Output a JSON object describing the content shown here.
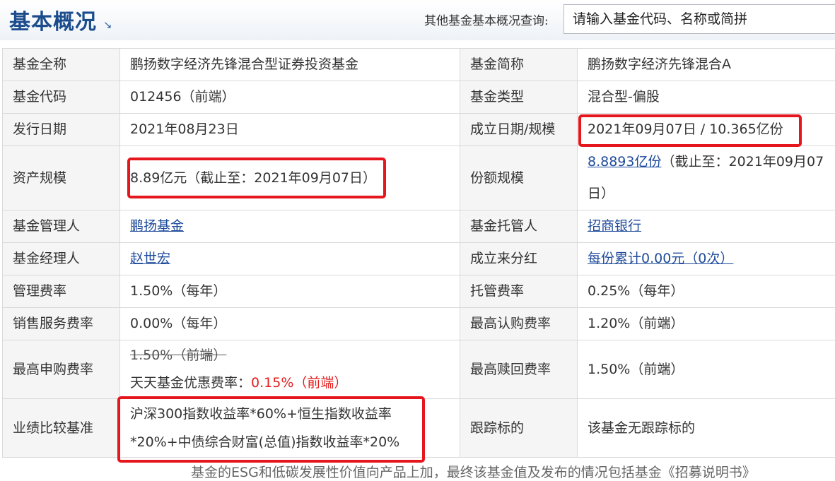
{
  "header": {
    "title": "基本概况",
    "arrow": "↘",
    "search_label": "其他基金基本概况查询:",
    "search_placeholder": "请输入基金代码、名称或简拼"
  },
  "rows": {
    "full_name": {
      "label": "基金全称",
      "value": "鹏扬数字经济先锋混合型证券投资基金"
    },
    "short_name": {
      "label": "基金简称",
      "value": "鹏扬数字经济先锋混合A"
    },
    "code": {
      "label": "基金代码",
      "value": "012456（前端）"
    },
    "type": {
      "label": "基金类型",
      "value": "混合型-偏股"
    },
    "issue_date": {
      "label": "发行日期",
      "value": "2021年08月23日"
    },
    "establish": {
      "label": "成立日期/规模",
      "value": "2021年09月07日 / 10.365亿份"
    },
    "assets": {
      "label": "资产规模",
      "value": "8.89亿元（截止至：2021年09月07日）"
    },
    "shares": {
      "label": "份额规模",
      "link": "8.8893亿份",
      "suffix": "（截止至：2021年09月07日）"
    },
    "manager_co": {
      "label": "基金管理人",
      "link": "鹏扬基金"
    },
    "custodian": {
      "label": "基金托管人",
      "link": "招商银行"
    },
    "manager": {
      "label": "基金经理人",
      "link": "赵世宏"
    },
    "dividend": {
      "label": "成立来分红",
      "link": "每份累计0.00元（0次）"
    },
    "mgmt_fee": {
      "label": "管理费率",
      "value": "1.50%（每年）"
    },
    "custody_fee": {
      "label": "托管费率",
      "value": "0.25%（每年）"
    },
    "sales_fee": {
      "label": "销售服务费率",
      "value": "0.00%（每年）"
    },
    "max_sub_fee": {
      "label": "最高认购费率",
      "value": "1.20%（前端）"
    },
    "max_purchase_fee": {
      "label": "最高申购费率",
      "original": "1.50%（前端）",
      "discount_label": "天天基金优惠费率：",
      "discount_value": "0.15%（前端）"
    },
    "max_redeem_fee": {
      "label": "最高赎回费率",
      "value": "1.50%（前端）"
    },
    "benchmark": {
      "label": "业绩比较基准",
      "line1": "沪深300指数收益率*60%+恒生指数收益率",
      "line2": "*20%+中债综合财富(总值)指数收益率*20%"
    },
    "tracking": {
      "label": "跟踪标的",
      "value": "该基金无跟踪标的"
    }
  },
  "footer": "基金的ESG和低碳发展性价值向产品上加，最终该基金值及发布的情况包括基金《招募说明书》"
}
